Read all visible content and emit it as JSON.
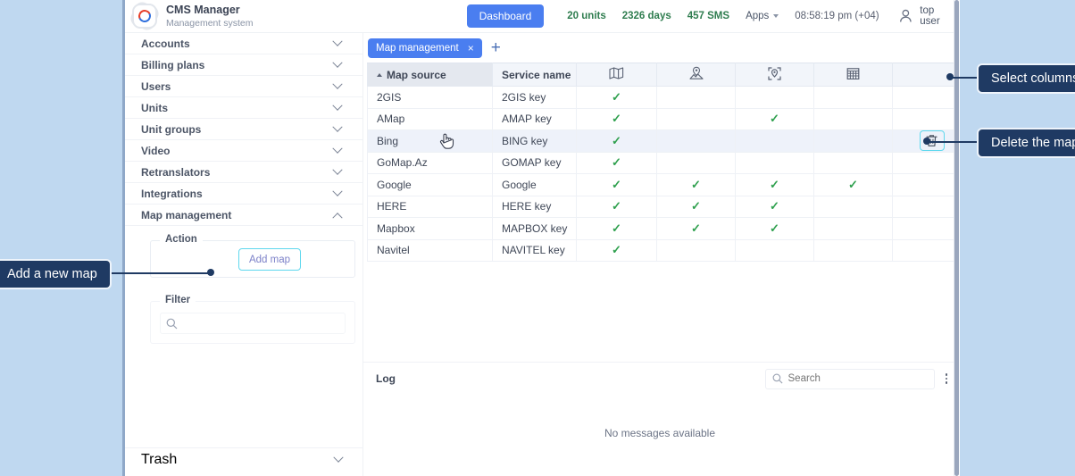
{
  "header": {
    "brand_title": "CMS Manager",
    "brand_subtitle": "Management system",
    "logo_icon": "gear-swirl-logo-icon",
    "dashboard_label": "Dashboard",
    "units_label": "20 units",
    "days_label": "2326 days",
    "sms_label": "457 SMS",
    "apps_label": "Apps",
    "time_label": "08:58:19 pm (+04)",
    "user_name": "top user",
    "user_icon": "user-avatar-icon",
    "accent_color": "#4a7ef0"
  },
  "sidebar": {
    "items": [
      {
        "label": "Accounts",
        "state": "collapsed"
      },
      {
        "label": "Billing plans",
        "state": "collapsed"
      },
      {
        "label": "Users",
        "state": "collapsed"
      },
      {
        "label": "Units",
        "state": "collapsed"
      },
      {
        "label": "Unit groups",
        "state": "collapsed"
      },
      {
        "label": "Video",
        "state": "collapsed"
      },
      {
        "label": "Retranslators",
        "state": "collapsed"
      },
      {
        "label": "Integrations",
        "state": "collapsed"
      },
      {
        "label": "Map management",
        "state": "expanded"
      }
    ],
    "action_legend": "Action",
    "add_map_label": "Add map",
    "filter_legend": "Filter",
    "filter_placeholder": "",
    "filter_value": "",
    "search_icon": "search-icon",
    "trash_label": "Trash"
  },
  "tabs": {
    "active_tab": "Map management",
    "close_glyph": "×",
    "add_glyph": "+"
  },
  "table": {
    "columns": [
      {
        "key": "source",
        "label": "Map source",
        "type": "text",
        "sorted": true
      },
      {
        "key": "service",
        "label": "Service name",
        "type": "text",
        "sorted": false
      },
      {
        "key": "map",
        "label": "",
        "type": "icon",
        "icon": "folded-map-icon"
      },
      {
        "key": "poi",
        "label": "",
        "type": "icon",
        "icon": "map-pin-terrain-icon"
      },
      {
        "key": "geocode",
        "label": "",
        "type": "icon",
        "icon": "locate-target-pin-icon"
      },
      {
        "key": "grid",
        "label": "",
        "type": "icon",
        "icon": "grid-geofence-icon"
      },
      {
        "key": "actions",
        "label": "",
        "type": "actions"
      },
      {
        "key": "menu",
        "label": "",
        "type": "columns-menu",
        "icon": "kebab-menu-icon"
      }
    ],
    "rows": [
      {
        "source": "2GIS",
        "service": "2GIS key",
        "map": true,
        "poi": false,
        "geocode": false,
        "grid": false,
        "highlighted": false,
        "delete_visible": false
      },
      {
        "source": "AMap",
        "service": "AMAP key",
        "map": true,
        "poi": false,
        "geocode": true,
        "grid": false,
        "highlighted": false,
        "delete_visible": false
      },
      {
        "source": "Bing",
        "service": "BING key",
        "map": true,
        "poi": false,
        "geocode": false,
        "grid": false,
        "highlighted": true,
        "delete_visible": true
      },
      {
        "source": "GoMap.Az",
        "service": "GOMAP key",
        "map": true,
        "poi": false,
        "geocode": false,
        "grid": false,
        "highlighted": false,
        "delete_visible": false
      },
      {
        "source": "Google",
        "service": "Google",
        "map": true,
        "poi": true,
        "geocode": true,
        "grid": true,
        "highlighted": false,
        "delete_visible": false
      },
      {
        "source": "HERE",
        "service": "HERE key",
        "map": true,
        "poi": true,
        "geocode": true,
        "grid": false,
        "highlighted": false,
        "delete_visible": false
      },
      {
        "source": "Mapbox",
        "service": "MAPBOX key",
        "map": true,
        "poi": true,
        "geocode": true,
        "grid": false,
        "highlighted": false,
        "delete_visible": false
      },
      {
        "source": "Navitel",
        "service": "NAVITEL key",
        "map": true,
        "poi": false,
        "geocode": false,
        "grid": false,
        "highlighted": false,
        "delete_visible": false
      }
    ],
    "check_glyph": "✓",
    "check_color": "#2fa04e",
    "delete_icon": "trash-icon"
  },
  "log": {
    "title": "Log",
    "search_placeholder": "Search",
    "search_value": "",
    "search_icon": "search-icon",
    "menu_icon": "kebab-menu-icon",
    "empty_message": "No messages available"
  },
  "callouts": [
    {
      "id": "select-columns",
      "text": "Select columns"
    },
    {
      "id": "delete-the-map",
      "text": "Delete the map"
    },
    {
      "id": "add-a-new-map",
      "text": "Add a new map"
    }
  ],
  "colors": {
    "page_background": "#bfd8f0",
    "callout_background": "#1f3a63",
    "highlight_outline": "#5fd8ee"
  }
}
